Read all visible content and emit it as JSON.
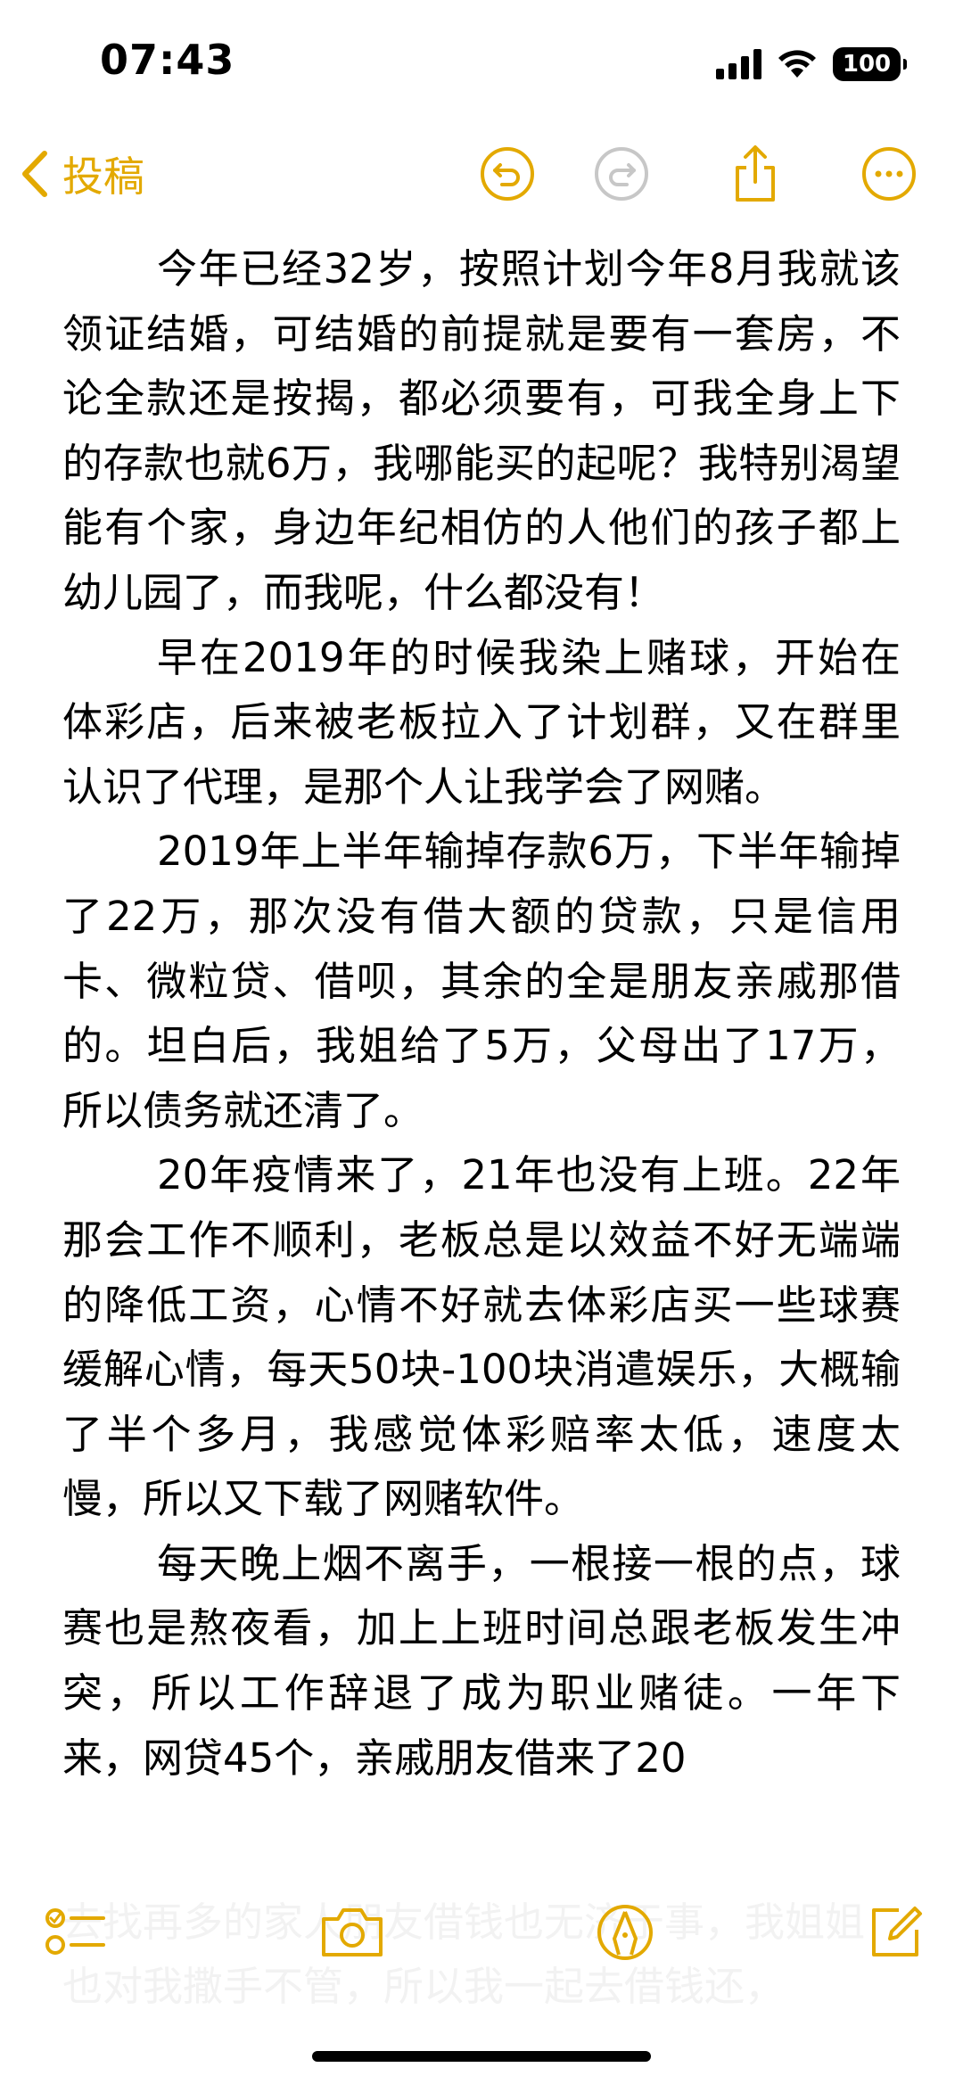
{
  "status": {
    "time": "07:43",
    "battery": "100"
  },
  "nav": {
    "back_label": "投稿"
  },
  "note": {
    "paragraphs": [
      "今年已经32岁，按照计划今年8月我就该领证结婚，可结婚的前提就是要有一套房，不论全款还是按揭，都必须要有，可我全身上下的存款也就6万，我哪能买的起呢？我特别渴望能有个家，身边年纪相仿的人他们的孩子都上幼儿园了，而我呢，什么都没有！",
      "早在2019年的时候我染上赌球，开始在体彩店，后来被老板拉入了计划群，又在群里认识了代理，是那个人让我学会了网赌。",
      "2019年上半年输掉存款6万，下半年输掉了22万，那次没有借大额的贷款，只是信用卡、微粒贷、借呗，其余的全是朋友亲戚那借的。坦白后，我姐给了5万，父母出了17万，所以债务就还清了。",
      "20年疫情来了，21年也没有上班。22年那会工作不顺利，老板总是以效益不好无端端的降低工资，心情不好就去体彩店买一些球赛缓解心情，每天50块-100块消遣娱乐，大概输了半个多月，我感觉体彩赔率太低，速度太慢，所以又下载了网赌软件。",
      "每天晚上烟不离手，一根接一根的点，球赛也是熬夜看，加上上班时间总跟老板发生冲突，所以工作辞退了成为职业赌徒。一年下来，网贷45个，亲戚朋友借来了20"
    ]
  },
  "ghost_text": "去找再多的家人朋友借钱也无济于事，我姐姐也对我撒手不管，所以我一起去借钱还，"
}
